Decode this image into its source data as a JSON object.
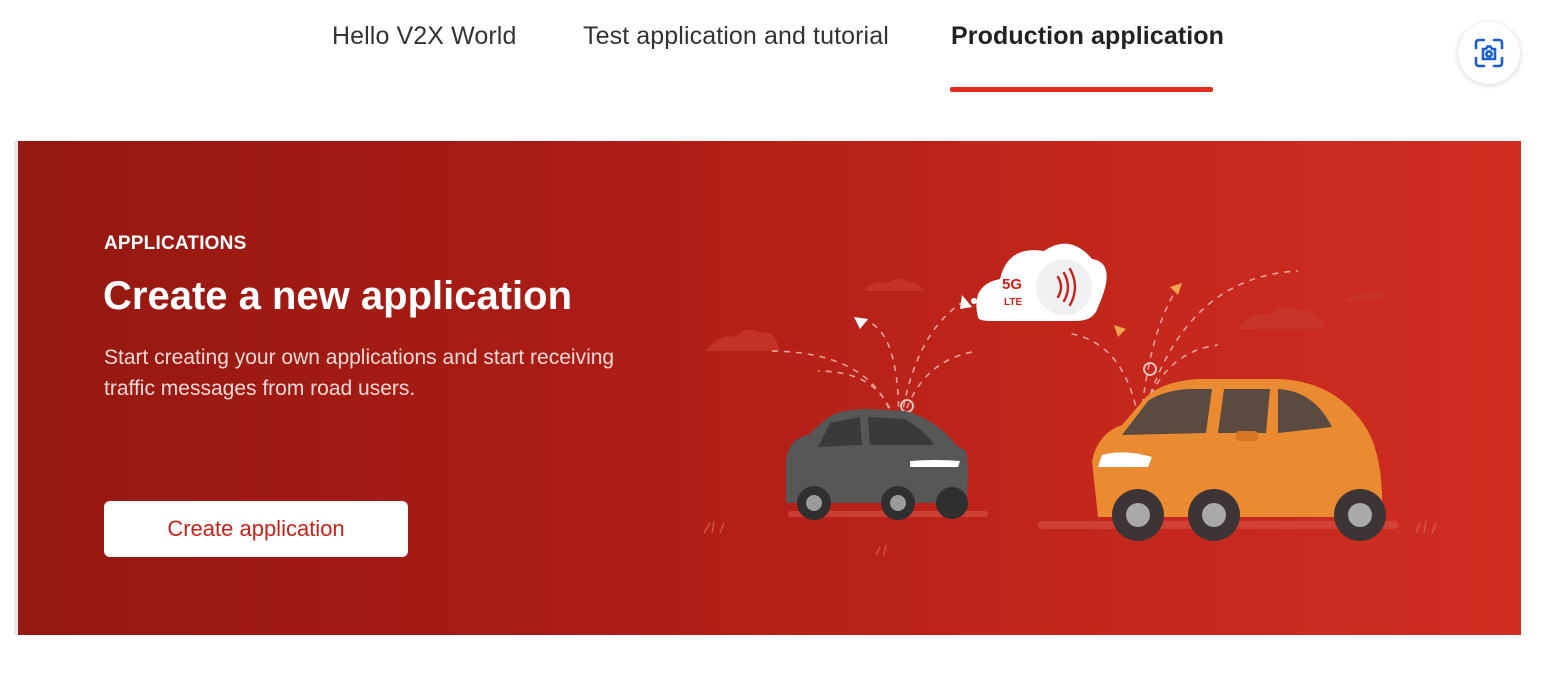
{
  "tabs": [
    {
      "label": "Hello V2X World",
      "active": false
    },
    {
      "label": "Test application and tutorial",
      "active": false
    },
    {
      "label": "Production application",
      "active": true
    }
  ],
  "lens_icon": "visual-search-icon",
  "banner": {
    "eyebrow": "APPLICATIONS",
    "title": "Create a new application",
    "description": "Start creating your own applications and start receiving traffic messages from road users.",
    "cta_label": "Create application",
    "cloud_label_top": "5G",
    "cloud_label_bottom": "LTE"
  },
  "colors": {
    "accent": "#e32b1e",
    "banner_start": "#951812",
    "banner_end": "#d12e22",
    "car_grey": "#4f4f4f",
    "car_orange": "#ea8b32"
  }
}
